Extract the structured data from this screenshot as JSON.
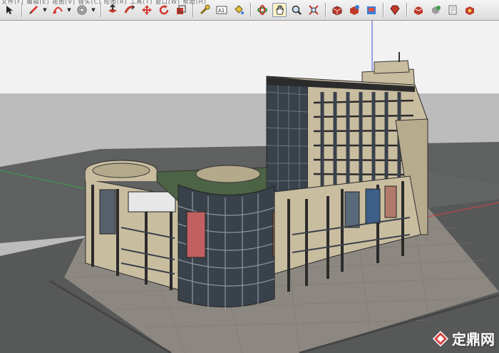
{
  "app": {
    "menu_ghost_text": "文件(F)  编辑(E)  视图(V)  镜头(C)  绘图(R)  工具(T)  窗口(W)  帮助(H)"
  },
  "toolbar": {
    "tools": [
      {
        "name": "select-icon"
      },
      {
        "name": "pencil-line-icon",
        "dropdown": true
      },
      {
        "name": "arc-icon",
        "dropdown": true
      },
      {
        "name": "offset-icon",
        "dropdown": true
      },
      {
        "name": "push-pull-icon"
      },
      {
        "name": "follow-me-icon"
      },
      {
        "name": "move-icon"
      },
      {
        "name": "rotate-icon"
      },
      {
        "name": "scale-icon"
      },
      {
        "name": "tape-measure-icon"
      },
      {
        "name": "text-icon"
      },
      {
        "name": "paint-bucket-icon"
      },
      {
        "name": "orbit-icon"
      },
      {
        "name": "pan-icon"
      },
      {
        "name": "zoom-icon"
      },
      {
        "name": "zoom-extents-icon"
      },
      {
        "name": "warehouse-icon"
      },
      {
        "name": "share-model-icon"
      },
      {
        "name": "extension-icon"
      },
      {
        "name": "ruby-icon"
      },
      {
        "name": "component-icon"
      },
      {
        "name": "shadow-icon"
      },
      {
        "name": "layer-icon"
      },
      {
        "name": "settings-icon"
      }
    ],
    "text_tool_label": "A1"
  },
  "colors": {
    "sky": "#f2f2f2",
    "ground": "#bcbcbc",
    "road": "#5f6060",
    "plaza": "#8c8780",
    "facade": "#c9bda0",
    "glass": "#39414a",
    "axis_blue": "#3c4fd8",
    "axis_green": "#37a34a",
    "axis_red": "#d94040"
  },
  "watermark": {
    "text": "定鼎网"
  }
}
